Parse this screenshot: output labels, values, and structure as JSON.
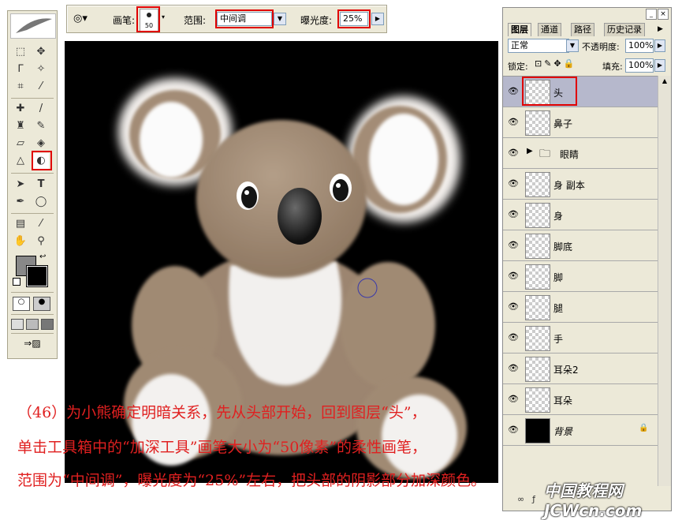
{
  "options_bar": {
    "brush_label": "画笔:",
    "brush_size": "50",
    "range_label": "范围:",
    "range_value": "中间调",
    "exposure_label": "曝光度:",
    "exposure_value": "25%"
  },
  "layers_panel": {
    "tabs": [
      "图层",
      "通道",
      "路径",
      "历史记录"
    ],
    "blend_mode": "正常",
    "opacity_label": "不透明度:",
    "opacity_value": "100%",
    "lock_label": "锁定:",
    "fill_label": "填充:",
    "fill_value": "100%",
    "layers": [
      {
        "name": "头",
        "selected": true
      },
      {
        "name": "鼻子"
      },
      {
        "name": "眼睛",
        "group": true
      },
      {
        "name": "身 副本"
      },
      {
        "name": "身"
      },
      {
        "name": "脚底"
      },
      {
        "name": "脚"
      },
      {
        "name": "腿"
      },
      {
        "name": "手"
      },
      {
        "name": "耳朵2"
      },
      {
        "name": "耳朵"
      },
      {
        "name": "背景",
        "locked": true
      }
    ]
  },
  "caption": {
    "line1": "（46）为小熊确定明暗关系，先从头部开始，回到图层“头”，",
    "line2": "单击工具箱中的“加深工具”画笔大小为“50像素”的柔性画笔，",
    "line3": "范围为“中间调”，曝光度为“25%”左右，把头部的阴影部分加深颜色。"
  },
  "watermark": "中国教程网 JCWcn.com",
  "colors": {
    "accent_red": "#e00000",
    "canvas_bg": "#000000",
    "koala_fur": "#a08a73"
  }
}
